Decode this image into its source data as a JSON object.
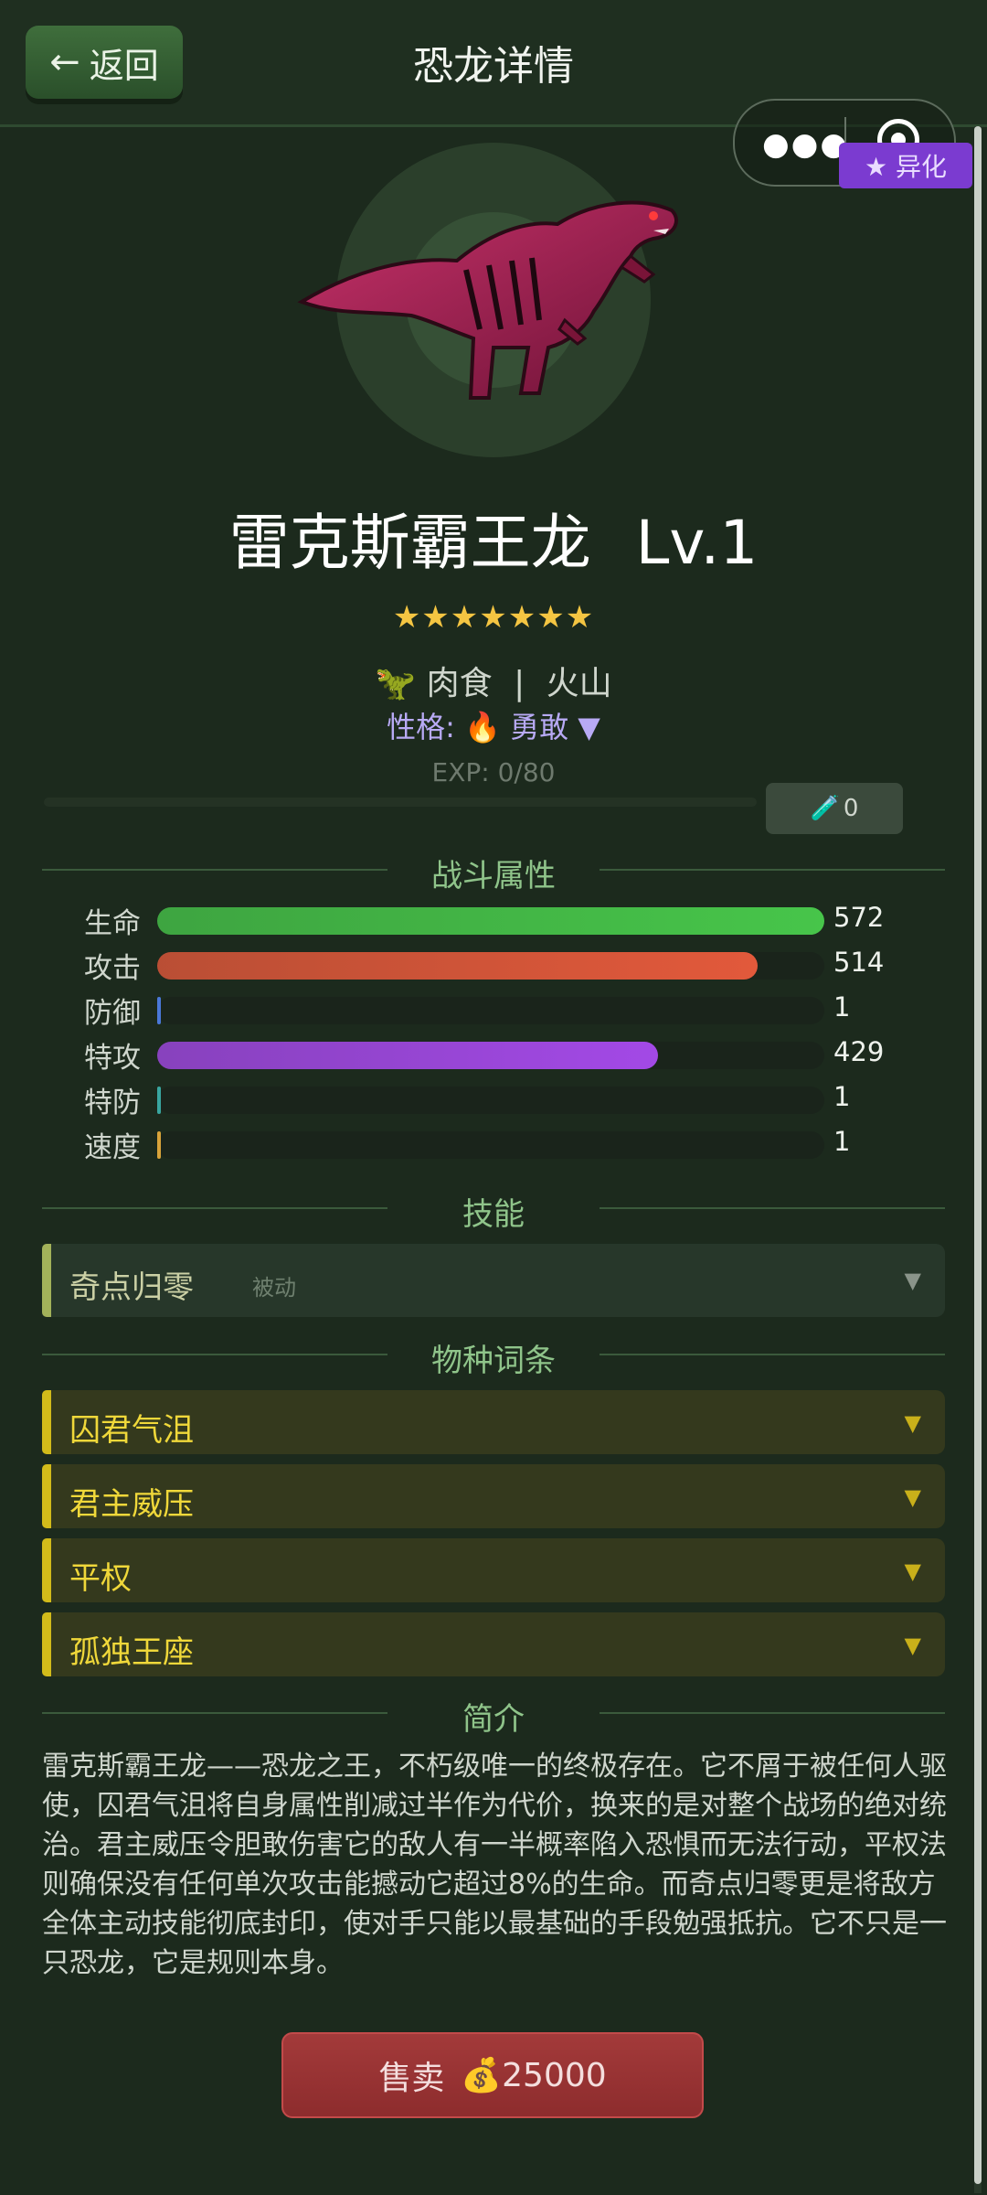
{
  "header": {
    "back_label": "返回",
    "title": "恐龙详情"
  },
  "top_right": {
    "evolve_label": "★ 异化"
  },
  "dino": {
    "name": "雷克斯霸王龙",
    "level": "Lv.1",
    "stars": "★★★★★★★",
    "diet": "肉食",
    "habitat": "火山",
    "nature_prefix": "性格:",
    "nature": "勇敢",
    "exp": "EXP: 0/80",
    "potion_count": "0"
  },
  "sections": {
    "battle": "战斗属性",
    "skills": "技能",
    "traits": "物种词条",
    "intro": "简介"
  },
  "stats": [
    {
      "name": "生命",
      "value": "572",
      "fraction": 1.0,
      "color": "#47c54a"
    },
    {
      "name": "攻击",
      "value": "514",
      "fraction": 0.9,
      "color": "#e2593b"
    },
    {
      "name": "防御",
      "value": "1",
      "fraction": 0.004,
      "color": "#4a78d8"
    },
    {
      "name": "特攻",
      "value": "429",
      "fraction": 0.75,
      "color": "#a349e6"
    },
    {
      "name": "特防",
      "value": "1",
      "fraction": 0.004,
      "color": "#39a6a0"
    },
    {
      "name": "速度",
      "value": "1",
      "fraction": 0.004,
      "color": "#d8a33a"
    }
  ],
  "skill": {
    "name": "奇点归零",
    "type": "被动"
  },
  "traits": [
    "囚君气沮",
    "君主威压",
    "平权",
    "孤独王座"
  ],
  "description": "雷克斯霸王龙——恐龙之王，不朽级唯一的终极存在。它不屑于被任何人驱使，囚君气沮将自身属性削减过半作为代价，换来的是对整个战场的绝对统治。君主威压令胆敢伤害它的敌人有一半概率陷入恐惧而无法行动，平权法则确保没有任何单次攻击能撼动它超过8%的生命。而奇点归零更是将敌方全体主动技能彻底封印，使对手只能以最基础的手段勉强抵抗。它不只是一只恐龙，它是规则本身。",
  "sell": {
    "label": "售卖",
    "price": "💰25000"
  }
}
